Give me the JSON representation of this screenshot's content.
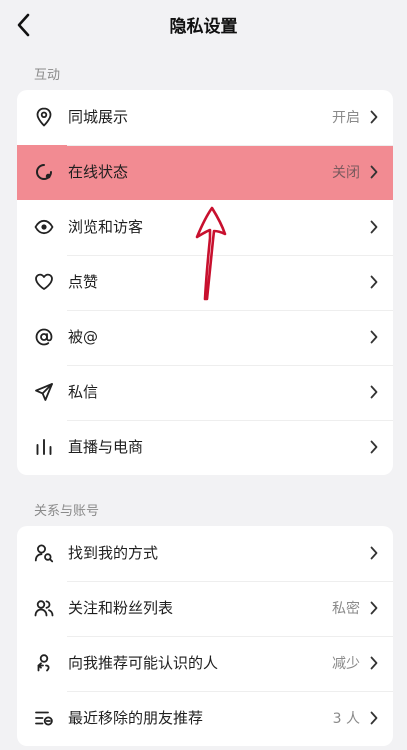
{
  "header": {
    "title": "隐私设置"
  },
  "sections": [
    {
      "label": "互动",
      "items": [
        {
          "label": "同城展示",
          "value": "开启",
          "icon": "location-pin-icon"
        },
        {
          "label": "在线状态",
          "value": "关闭",
          "icon": "online-status-icon",
          "highlighted": true
        },
        {
          "label": "浏览和访客",
          "value": "",
          "icon": "eye-icon"
        },
        {
          "label": "点赞",
          "value": "",
          "icon": "heart-icon"
        },
        {
          "label": "被@",
          "value": "",
          "icon": "at-icon"
        },
        {
          "label": "私信",
          "value": "",
          "icon": "paper-plane-icon"
        },
        {
          "label": "直播与电商",
          "value": "",
          "icon": "bar-chart-icon"
        }
      ]
    },
    {
      "label": "关系与账号",
      "items": [
        {
          "label": "找到我的方式",
          "value": "",
          "icon": "user-search-icon"
        },
        {
          "label": "关注和粉丝列表",
          "value": "私密",
          "icon": "users-icon"
        },
        {
          "label": "向我推荐可能认识的人",
          "value": "减少",
          "icon": "user-recommend-icon"
        },
        {
          "label": "最近移除的朋友推荐",
          "value": "3 人",
          "icon": "list-removed-icon"
        }
      ]
    }
  ],
  "colors": {
    "highlight": "#f28b92",
    "annotation_arrow": "#c8102e"
  }
}
